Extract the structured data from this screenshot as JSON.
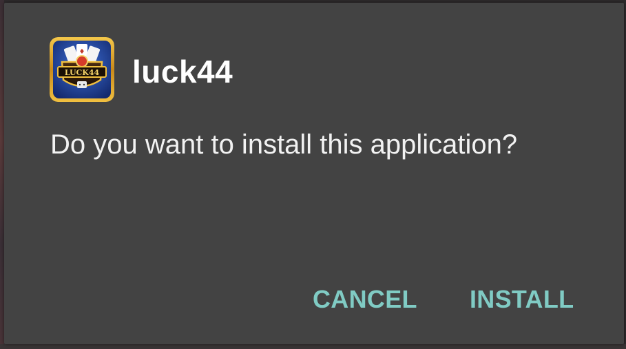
{
  "dialog": {
    "app_name": "luck44",
    "icon": "luck44-app-icon",
    "icon_text": "LUCK44",
    "message": "Do you want to install this application?",
    "buttons": {
      "cancel_label": "CANCEL",
      "install_label": "INSTALL"
    }
  },
  "colors": {
    "dialog_background": "#434343",
    "button_text": "#80cbc4",
    "title_text": "#ffffff",
    "body_text": "#f2f2f2"
  }
}
